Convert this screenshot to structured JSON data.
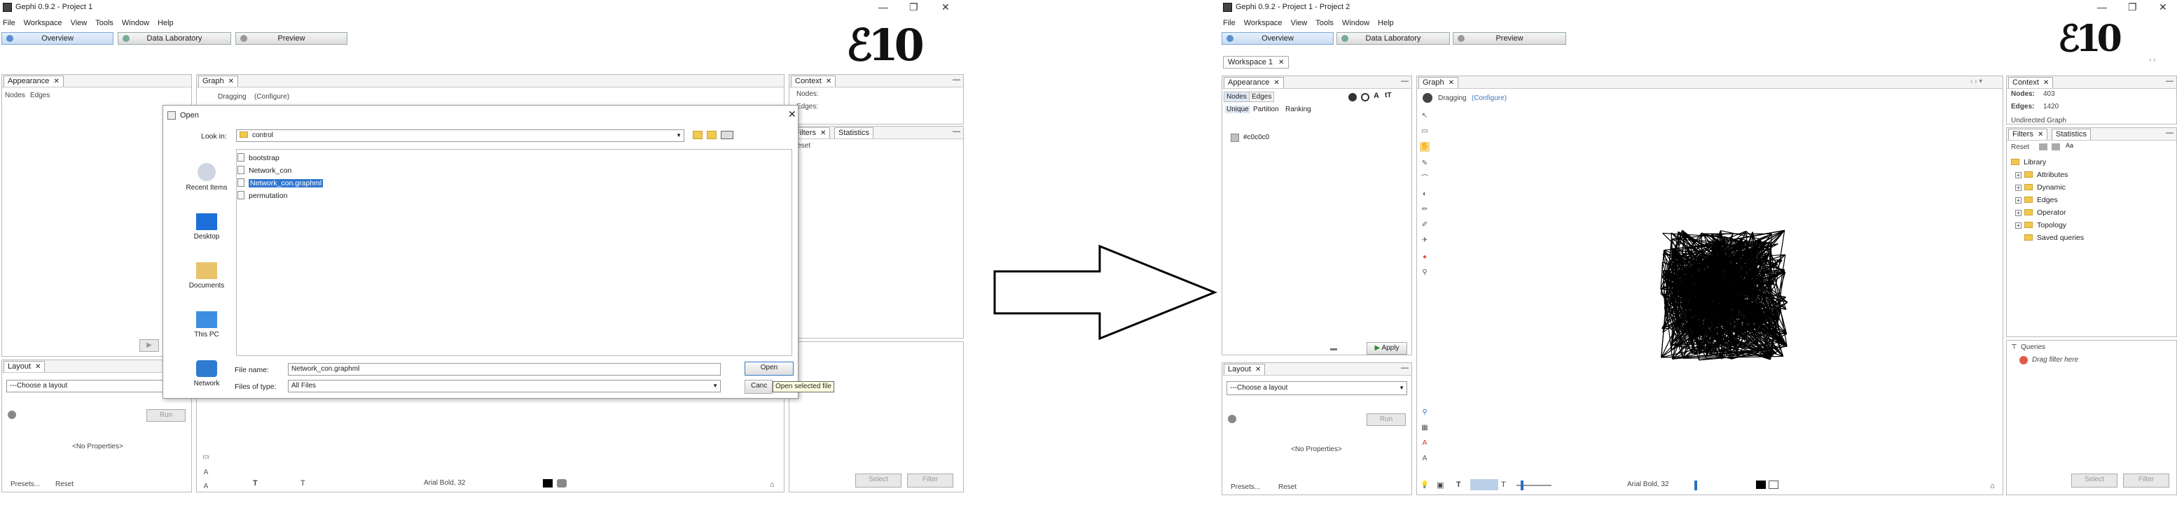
{
  "left": {
    "title": "Gephi 0.9.2 - Project 1",
    "menu": [
      "File",
      "Workspace",
      "View",
      "Tools",
      "Window",
      "Help"
    ],
    "nav": {
      "overview": "Overview",
      "data_lab": "Data Laboratory",
      "preview": "Preview"
    },
    "appearance": {
      "tab": "Appearance",
      "nodes": "Nodes",
      "edges": "Edges"
    },
    "graph": {
      "tab": "Graph",
      "mode": "Dragging",
      "configure": "(Configure)"
    },
    "context": {
      "tab": "Context",
      "nodes": "Nodes:",
      "edges": "Edges:"
    },
    "filters": {
      "tab": "Filters",
      "reset": "Reset"
    },
    "statistics": {
      "tab": "Statistics"
    },
    "layout": {
      "tab": "Layout",
      "choose": "---Choose a layout",
      "run": "Run",
      "no_props": "<No Properties>",
      "presets": "Presets...",
      "reset": "Reset"
    },
    "bottom_bar": {
      "font": "Arial Bold, 32",
      "select": "Select",
      "filter": "Filter"
    },
    "dialog": {
      "title": "Open",
      "look_in_label": "Look in:",
      "look_in_value": "control",
      "places": [
        "Recent Items",
        "Desktop",
        "Documents",
        "This PC",
        "Network"
      ],
      "files": [
        "bootstrap",
        "Network_con",
        "Network_con.graphml",
        "permutation"
      ],
      "selected_file": "Network_con.graphml",
      "file_name_label": "File name:",
      "file_name_value": "Network_con.graphml",
      "file_type_label": "Files of type:",
      "file_type_value": "All Files",
      "open_label": "Open",
      "cancel_label": "Canc",
      "tooltip": "Open selected file"
    }
  },
  "right": {
    "title": "Gephi 0.9.2 - Project 1 - Project 2",
    "menu": [
      "File",
      "Workspace",
      "View",
      "Tools",
      "Window",
      "Help"
    ],
    "nav": {
      "overview": "Overview",
      "data_lab": "Data Laboratory",
      "preview": "Preview"
    },
    "workspace_tab": "Workspace 1",
    "appearance": {
      "tab": "Appearance",
      "nodes": "Nodes",
      "edges": "Edges",
      "unique": "Unique",
      "partition": "Partition",
      "ranking": "Ranking",
      "color_value": "#c0c0c0",
      "apply": "Apply"
    },
    "graph": {
      "tab": "Graph",
      "mode": "Dragging",
      "configure": "(Configure)"
    },
    "context": {
      "tab": "Context",
      "nodes_label": "Nodes:",
      "nodes_value": "403",
      "edges_label": "Edges:",
      "edges_value": "1420",
      "extra": "Undirected Graph"
    },
    "filters": {
      "tab": "Filters",
      "reset": "Reset",
      "library": "Library",
      "items": [
        "Attributes",
        "Dynamic",
        "Edges",
        "Operator",
        "Topology"
      ],
      "saved": "Saved queries",
      "queries": "Queries",
      "drag_hint": "Drag filter here"
    },
    "statistics": {
      "tab": "Statistics"
    },
    "layout": {
      "tab": "Layout",
      "choose": "---Choose a layout",
      "run": "Run",
      "no_props": "<No Properties>",
      "presets": "Presets...",
      "reset": "Reset"
    },
    "bottom_bar": {
      "font": "Arial Bold, 32",
      "select": "Select",
      "filter": "Filter"
    }
  },
  "colors": {
    "accent": "#3a78c4",
    "selection": "#3176d0",
    "graph_fill": "#000000"
  }
}
